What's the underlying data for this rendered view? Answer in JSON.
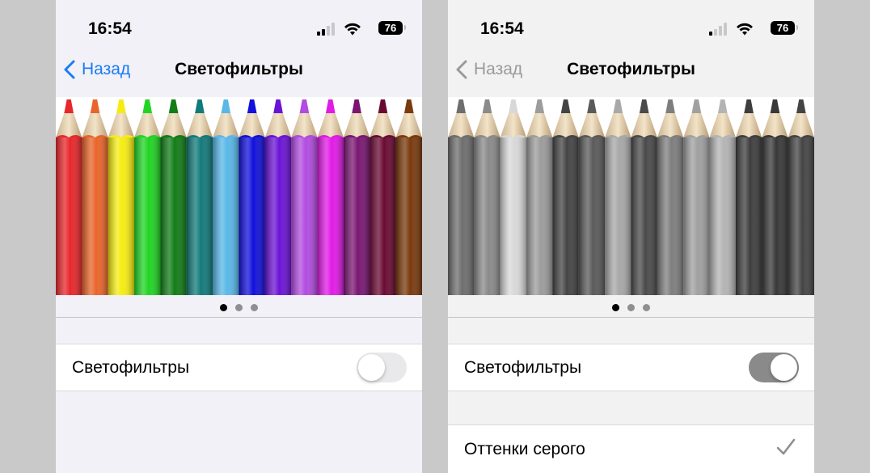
{
  "left": {
    "status": {
      "time": "16:54",
      "battery": "76"
    },
    "nav": {
      "back_label": "Назад",
      "title": "Светофильтры"
    },
    "accent": "#1a7cf5",
    "pencil_colors": [
      "#e8272a",
      "#e9652a",
      "#f5ec12",
      "#21d424",
      "#117d17",
      "#137a7a",
      "#59b8e8",
      "#1210dc",
      "#6a13d6",
      "#b24ce0",
      "#e11ae6",
      "#7a1672",
      "#6a0a33",
      "#7a3a0d"
    ],
    "pager": {
      "count": 3,
      "active": 0
    },
    "row": {
      "label": "Светофильтры",
      "toggle_on": false
    }
  },
  "right": {
    "status": {
      "time": "16:54",
      "battery": "76"
    },
    "nav": {
      "back_label": "Назад",
      "title": "Светофильтры"
    },
    "accent": "#9a9a9a",
    "pencil_colors": [
      "#6e6e6e",
      "#8a8a8a",
      "#d8d8d8",
      "#9c9c9c",
      "#444444",
      "#5a5a5a",
      "#a8a8a8",
      "#4a4a4a",
      "#7e7e7e",
      "#a0a0a0",
      "#b4b4b4",
      "#3e3e3e",
      "#383838",
      "#444444"
    ],
    "pager": {
      "count": 3,
      "active": 0
    },
    "row": {
      "label": "Светофильтры",
      "toggle_on": true
    },
    "option": {
      "label": "Оттенки серого",
      "checked": true
    }
  }
}
